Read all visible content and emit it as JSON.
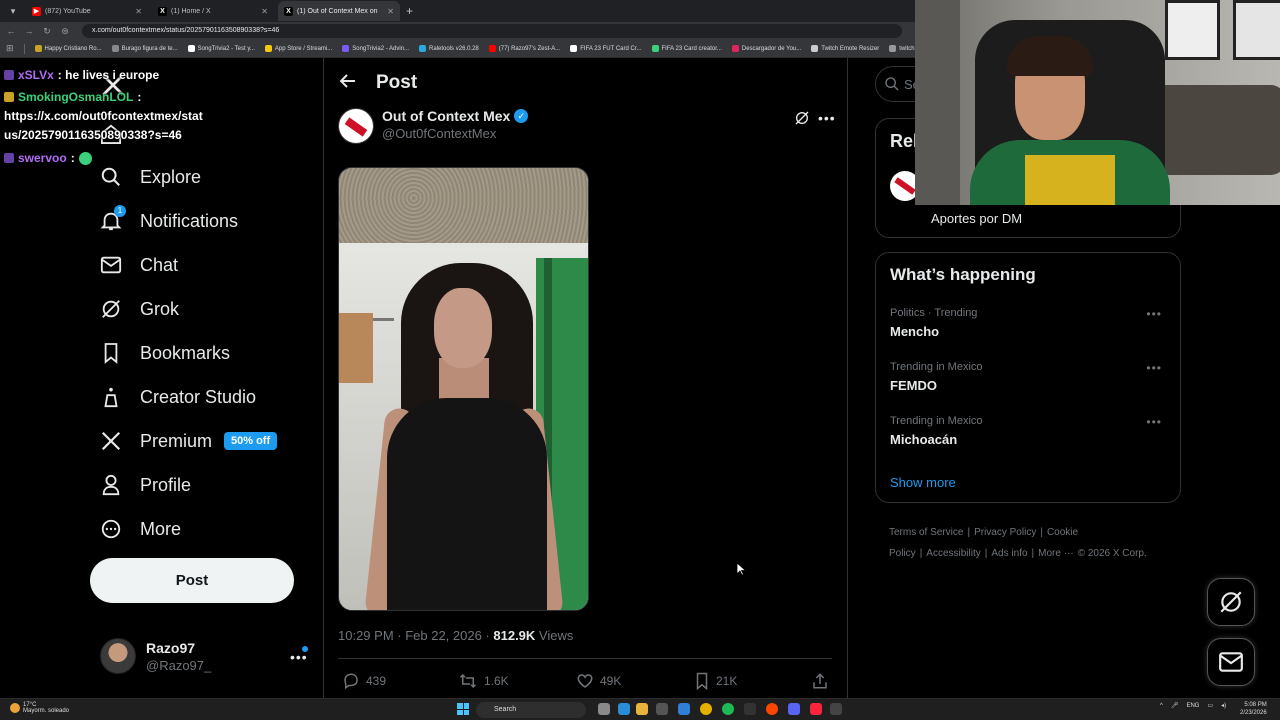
{
  "browser": {
    "tabs": [
      {
        "title": "(872) YouTube",
        "favicon_color": "#ff0000",
        "favicon_glyph": "▶",
        "active": false
      },
      {
        "title": "(1) Home / X",
        "favicon_color": "#000000",
        "favicon_glyph": "X",
        "active": false
      },
      {
        "title": "(1) Out of Context Mex on",
        "favicon_color": "#000000",
        "favicon_glyph": "X",
        "active": true
      }
    ],
    "url": "x.com/out0fcontextmex/status/2025790116350890338?s=46",
    "bookmarks": [
      {
        "label": "Happy Cristiano Ro...",
        "color": "#c9a227"
      },
      {
        "label": "Burago figura de te...",
        "color": "#888888"
      },
      {
        "label": "SongTrivia2 - Test y...",
        "color": "#ffffff"
      },
      {
        "label": "App Store / Streami...",
        "color": "#f2c811"
      },
      {
        "label": "SongTrivia2 - Advin...",
        "color": "#7a5af8"
      },
      {
        "label": "Raletools v26.0.28",
        "color": "#2aa9e0"
      },
      {
        "label": "(77) Razo97's Zest-A...",
        "color": "#ff0000"
      },
      {
        "label": "FIFA 23 FUT Card Cr...",
        "color": "#ffffff"
      },
      {
        "label": "FIFA 23 Card creator...",
        "color": "#3ad17a"
      },
      {
        "label": "Descargador de You...",
        "color": "#e0245e"
      },
      {
        "label": "Twitch Emote Resizer",
        "color": "#cccccc"
      },
      {
        "label": "twitch emote re...",
        "color": "#999999"
      }
    ]
  },
  "chat": [
    {
      "user": "xSLVx",
      "user_color": "#b16cf5",
      "text": ": he lives i europe",
      "icon_color": "#6441a5"
    },
    {
      "user": "SmokingOsmanLOL",
      "user_color": "#3ad17a",
      "text": ":",
      "icon_color": "#c9a227"
    },
    {
      "user": "",
      "user_color": "#ffffff",
      "text": "https://x.com/out0fcontextmex/stat",
      "icon_color": ""
    },
    {
      "user": "",
      "user_color": "#ffffff",
      "text": "us/2025790116350890338?s=46",
      "icon_color": ""
    },
    {
      "user": "swervoo",
      "user_color": "#b16cf5",
      "text": ":",
      "icon_color": "#6441a5",
      "emote": "green-emote"
    }
  ],
  "nav": {
    "items": [
      {
        "label": "Explore",
        "icon": "search-icon"
      },
      {
        "label": "Notifications",
        "icon": "bell-icon",
        "badge": "1"
      },
      {
        "label": "Chat",
        "icon": "mail-icon"
      },
      {
        "label": "Grok",
        "icon": "grok-icon"
      },
      {
        "label": "Bookmarks",
        "icon": "bookmark-icon"
      },
      {
        "label": "Creator Studio",
        "icon": "creator-studio-icon"
      },
      {
        "label": "Premium",
        "icon": "x-logo-icon",
        "badge_text": "50% off"
      },
      {
        "label": "Profile",
        "icon": "person-icon"
      },
      {
        "label": "More",
        "icon": "more-circle-icon"
      }
    ],
    "post_button": "Post",
    "account": {
      "name": "Razo97",
      "handle": "@Razo97_"
    }
  },
  "post": {
    "header_title": "Post",
    "author_name": "Out of Context Mex",
    "author_handle": "@Out0fContextMex",
    "verified": true,
    "timestamp": "10:29 PM · Feb 22, 2026 · ",
    "views_count": "812.9K",
    "views_label": " Views",
    "actions": {
      "replies": "439",
      "reposts": "1.6K",
      "likes": "49K",
      "bookmarks": "21K"
    }
  },
  "sidebar": {
    "search_placeholder": "Se",
    "relevant_title": "Rel",
    "relevant_sub": "Aportes por DM",
    "happening_title": "What’s happening",
    "trends": [
      {
        "context": "Politics · Trending",
        "name": "Mencho"
      },
      {
        "context": "Trending in Mexico",
        "name": "FEMDO"
      },
      {
        "context": "Trending in Mexico",
        "name": "Michoacán"
      }
    ],
    "show_more": "Show more",
    "footer": [
      "Terms of Service",
      "|",
      "Privacy Policy",
      "|",
      "Cookie Policy",
      "|",
      "Accessibility",
      "|",
      "Ads info",
      "|",
      "More ···",
      "© 2026 X Corp."
    ]
  },
  "taskbar": {
    "weather_temp": "17°C",
    "weather_desc": "Mayorm. soleado",
    "search_label": "Search",
    "lang": "ENG",
    "time": "5:08 PM",
    "date": "2/23/2026"
  },
  "colors": {
    "accent": "#1d9bf0",
    "background": "#000000",
    "text": "#e7e9ea",
    "muted": "#71767b"
  }
}
